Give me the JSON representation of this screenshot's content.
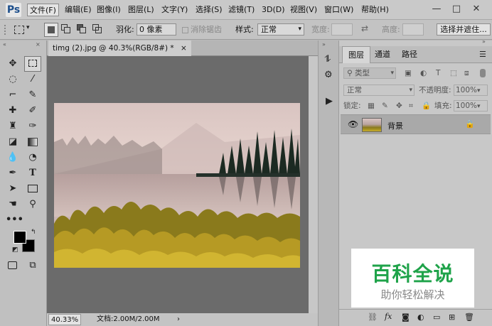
{
  "app": {
    "logo": "Ps"
  },
  "menu": [
    "文件(F)",
    "编辑(E)",
    "图像(I)",
    "图层(L)",
    "文字(Y)",
    "选择(S)",
    "滤镜(T)",
    "3D(D)",
    "视图(V)",
    "窗口(W)",
    "帮助(H)"
  ],
  "window": {
    "min": "—",
    "restore": "□",
    "close": "✕"
  },
  "options": {
    "feather_label": "羽化:",
    "feather_value": "0 像素",
    "antialias_label": "消除锯齿",
    "style_label": "样式:",
    "style_value": "正常",
    "width_label": "宽度:",
    "height_label": "高度:",
    "select_mask_button": "选择并遮住..."
  },
  "document": {
    "tab_title": "timg (2).jpg @ 40.3%(RGB/8#) *",
    "tab_close": "×",
    "zoom": "40.33%",
    "doc_info": "文档:2.00M/2.00M",
    "status_arrow": "›"
  },
  "layers_panel": {
    "tabs": [
      "图层",
      "通道",
      "路径"
    ],
    "filter_kind": "类型",
    "blend_mode": "正常",
    "opacity_label": "不透明度:",
    "opacity_value": "100%",
    "lock_label": "锁定:",
    "fill_label": "填充:",
    "fill_value": "100%",
    "layer_name": "背景"
  },
  "watermark": {
    "title": "百科全说",
    "subtitle": "助你轻松解决"
  },
  "colors": {
    "accent_green": "#1fa34a",
    "watermark_gray": "#888888",
    "foreground": "#000000",
    "background": "#000000"
  }
}
